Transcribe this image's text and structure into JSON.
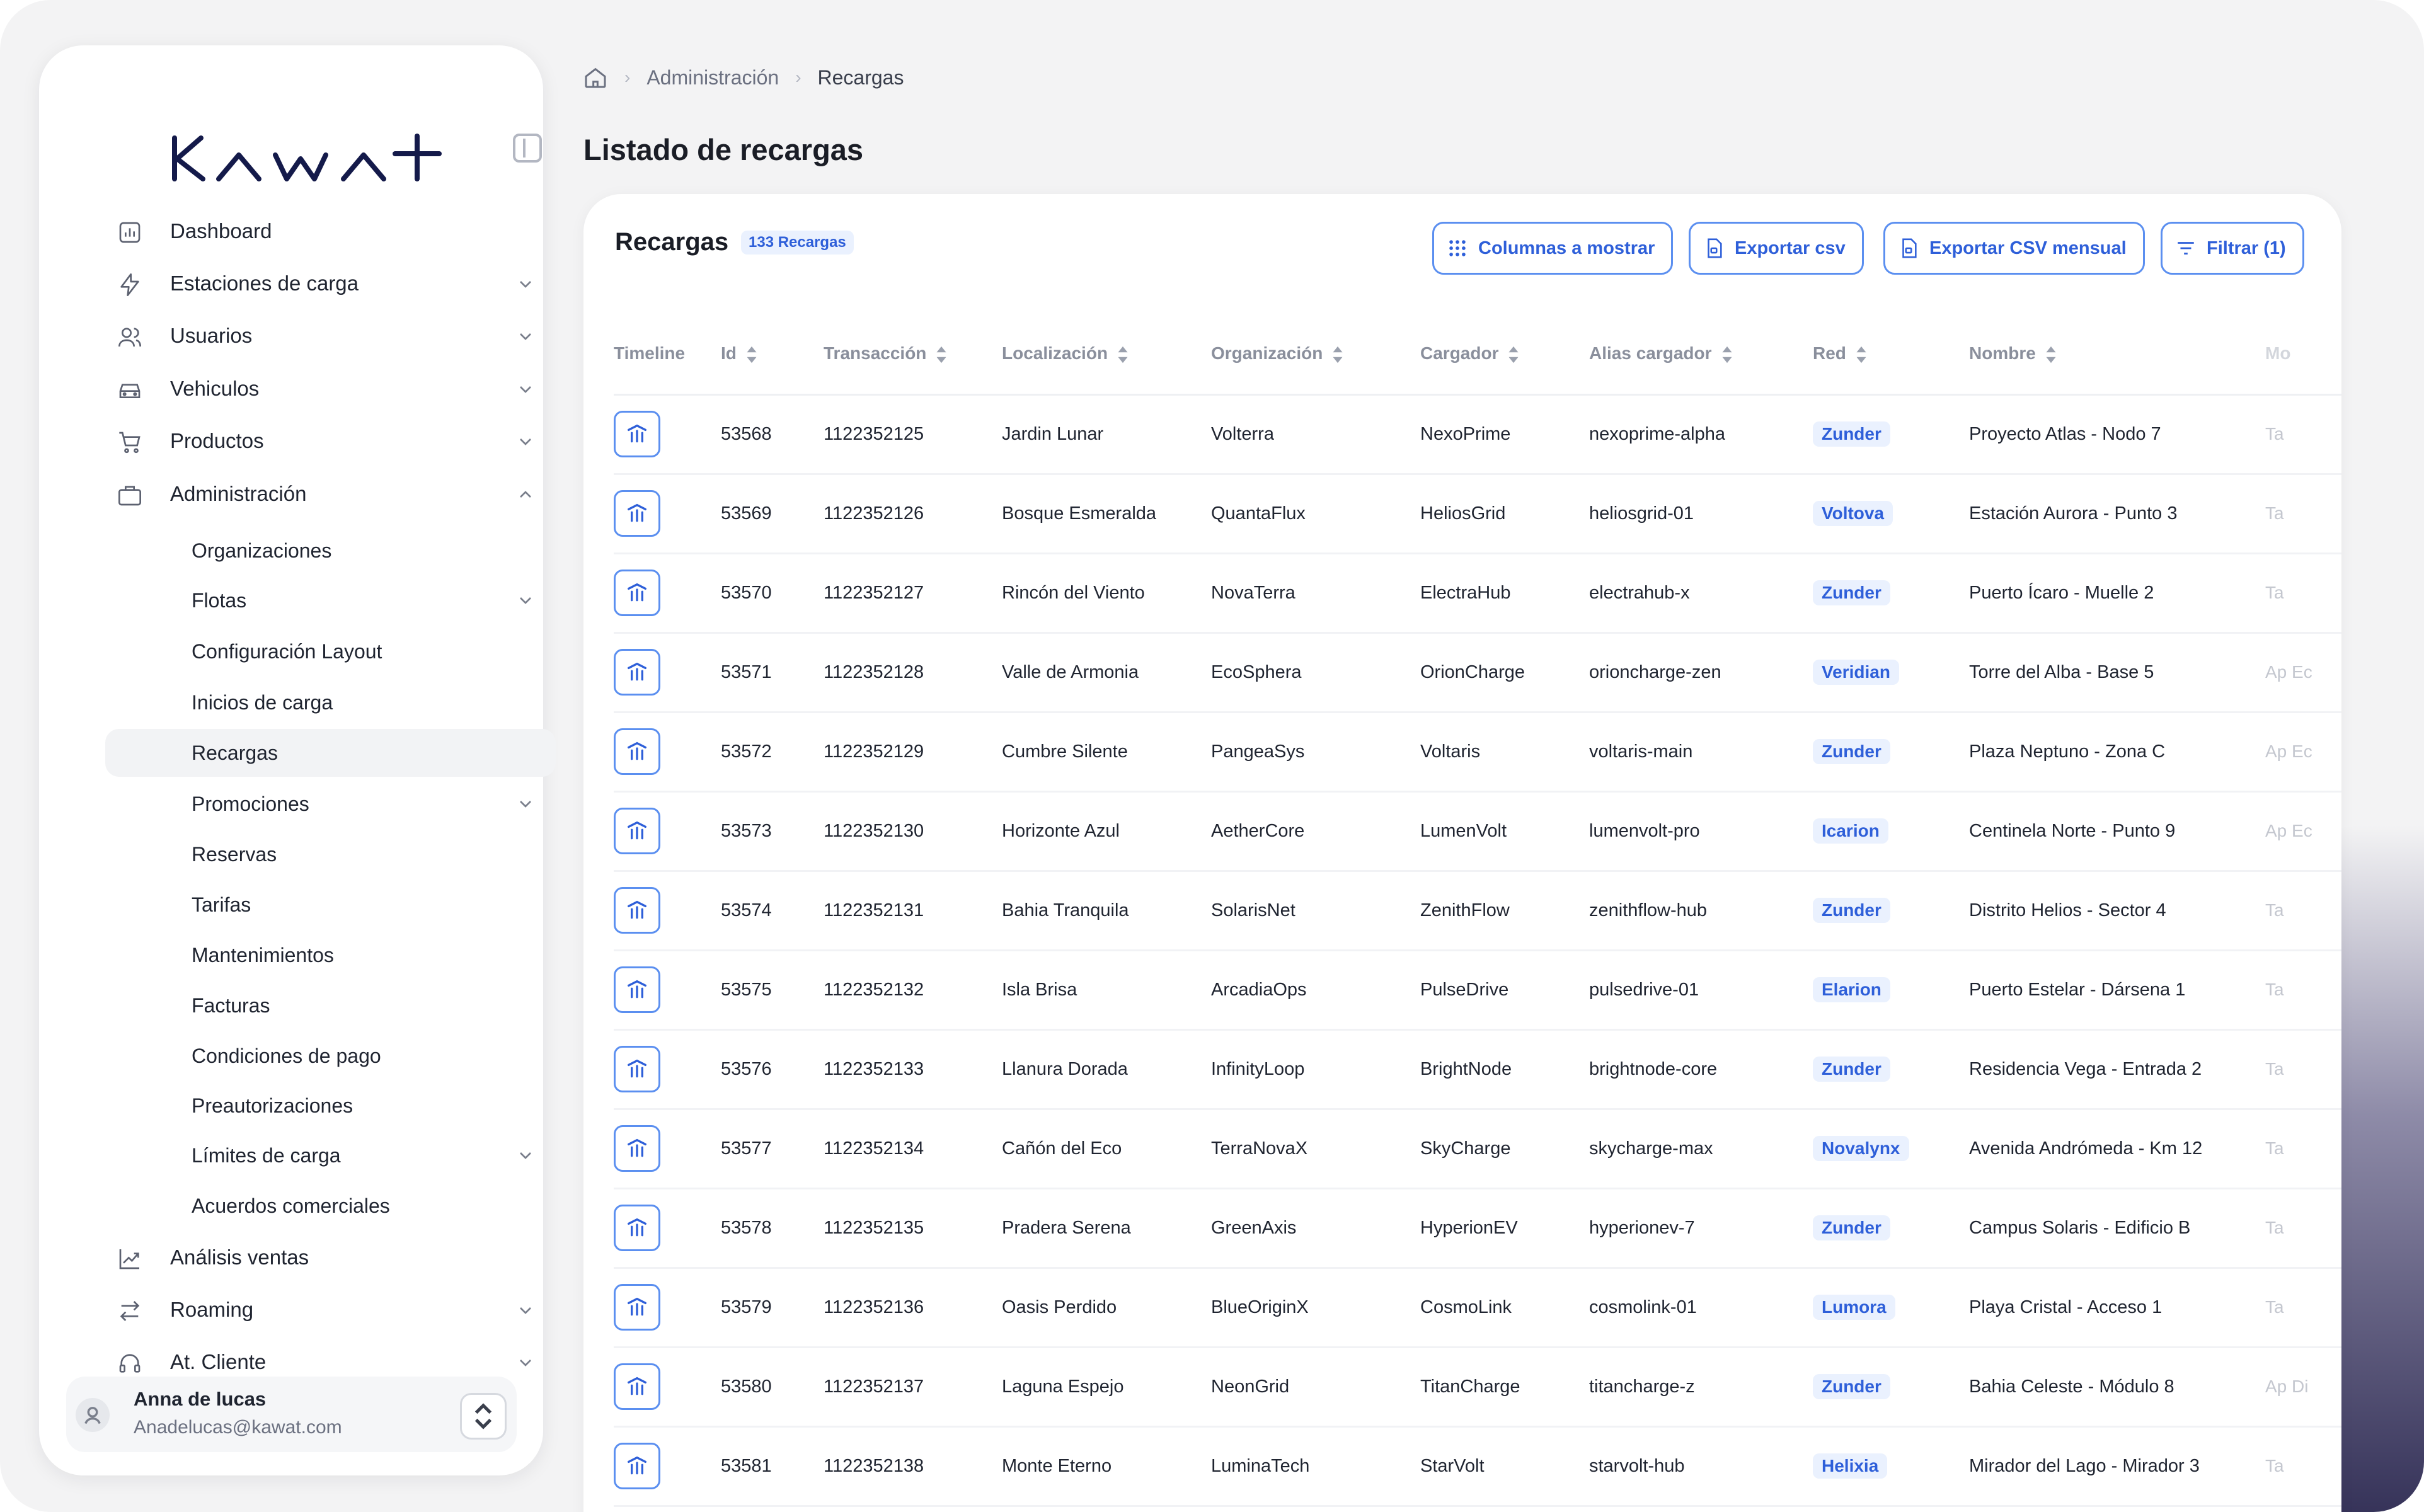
{
  "app": {
    "logo_text": "KAWAT",
    "accent_color": "#2e5fd9",
    "logo_color": "#141a4a"
  },
  "sidebar": {
    "items": [
      {
        "label": "Dashboard",
        "icon": "chart-icon",
        "expandable": false
      },
      {
        "label": "Estaciones de carga",
        "icon": "lightning-icon",
        "expandable": true
      },
      {
        "label": "Usuarios",
        "icon": "users-icon",
        "expandable": true
      },
      {
        "label": "Vehiculos",
        "icon": "car-icon",
        "expandable": true
      },
      {
        "label": "Productos",
        "icon": "cart-icon",
        "expandable": true
      },
      {
        "label": "Administración",
        "icon": "briefcase-icon",
        "expandable": true,
        "expanded": true
      }
    ],
    "admin_subitems": [
      {
        "label": "Organizaciones",
        "expandable": false
      },
      {
        "label": "Flotas",
        "expandable": true
      },
      {
        "label": "Configuración Layout",
        "expandable": false
      },
      {
        "label": "Inicios de carga",
        "expandable": false
      },
      {
        "label": "Recargas",
        "expandable": false,
        "active": true
      },
      {
        "label": "Promociones",
        "expandable": true
      },
      {
        "label": "Reservas",
        "expandable": false
      },
      {
        "label": "Tarifas",
        "expandable": false
      },
      {
        "label": "Mantenimientos",
        "expandable": false
      },
      {
        "label": "Facturas",
        "expandable": false
      },
      {
        "label": "Condiciones de pago",
        "expandable": false
      },
      {
        "label": "Preautorizaciones",
        "expandable": false
      },
      {
        "label": "Límites de carga",
        "expandable": true
      },
      {
        "label": "Acuerdos comerciales",
        "expandable": false
      }
    ],
    "bottom_items": [
      {
        "label": "Análisis ventas",
        "icon": "trend-icon",
        "expandable": false
      },
      {
        "label": "Roaming",
        "icon": "arrows-swap-icon",
        "expandable": true
      },
      {
        "label": "At. Cliente",
        "icon": "headset-icon",
        "expandable": true
      }
    ],
    "user": {
      "name": "Anna de lucas",
      "email": "Anadelucas@kawat.com"
    }
  },
  "breadcrumb": {
    "items": [
      "Administración",
      "Recargas"
    ]
  },
  "page": {
    "title": "Listado de recargas"
  },
  "card": {
    "title": "Recargas",
    "count_badge": "133 Recargas",
    "buttons": {
      "columns": "Columnas a mostrar",
      "export_csv": "Exportar csv",
      "export_monthly": "Exportar CSV mensual",
      "filter": "Filtrar (1)"
    }
  },
  "table": {
    "columns": [
      "Timeline",
      "Id",
      "Transacción",
      "Localización",
      "Organización",
      "Cargador",
      "Alias cargador",
      "Red",
      "Nombre",
      "Mo"
    ],
    "rows": [
      {
        "id": "53568",
        "tx": "1122352125",
        "loc": "Jardin Lunar",
        "org": "Volterra",
        "charger": "NexoPrime",
        "alias": "nexoprime-alpha",
        "net": "Zunder",
        "name": "Proyecto Atlas - Nodo 7",
        "extra": "Ta"
      },
      {
        "id": "53569",
        "tx": "1122352126",
        "loc": "Bosque Esmeralda",
        "org": "QuantaFlux",
        "charger": "HeliosGrid",
        "alias": "heliosgrid-01",
        "net": "Voltova",
        "name": "Estación Aurora - Punto 3",
        "extra": "Ta"
      },
      {
        "id": "53570",
        "tx": "1122352127",
        "loc": "Rincón del Viento",
        "org": "NovaTerra",
        "charger": "ElectraHub",
        "alias": "electrahub-x",
        "net": "Zunder",
        "name": "Puerto Ícaro - Muelle 2",
        "extra": "Ta"
      },
      {
        "id": "53571",
        "tx": "1122352128",
        "loc": "Valle de Armonia",
        "org": "EcoSphera",
        "charger": "OrionCharge",
        "alias": "orioncharge-zen",
        "net": "Veridian",
        "name": "Torre del Alba - Base 5",
        "extra": "Ap Ec"
      },
      {
        "id": "53572",
        "tx": "1122352129",
        "loc": "Cumbre Silente",
        "org": "PangeaSys",
        "charger": "Voltaris",
        "alias": "voltaris-main",
        "net": "Zunder",
        "name": "Plaza Neptuno - Zona C",
        "extra": "Ap Ec"
      },
      {
        "id": "53573",
        "tx": "1122352130",
        "loc": "Horizonte Azul",
        "org": "AetherCore",
        "charger": "LumenVolt",
        "alias": "lumenvolt-pro",
        "net": "Icarion",
        "name": "Centinela Norte - Punto 9",
        "extra": "Ap Ec"
      },
      {
        "id": "53574",
        "tx": "1122352131",
        "loc": "Bahia Tranquila",
        "org": "SolarisNet",
        "charger": "ZenithFlow",
        "alias": "zenithflow-hub",
        "net": "Zunder",
        "name": "Distrito Helios - Sector 4",
        "extra": "Ta"
      },
      {
        "id": "53575",
        "tx": "1122352132",
        "loc": "Isla Brisa",
        "org": "ArcadiaOps",
        "charger": "PulseDrive",
        "alias": "pulsedrive-01",
        "net": "Elarion",
        "name": "Puerto Estelar - Dársena 1",
        "extra": "Ta"
      },
      {
        "id": "53576",
        "tx": "1122352133",
        "loc": "Llanura Dorada",
        "org": "InfinityLoop",
        "charger": "BrightNode",
        "alias": "brightnode-core",
        "net": "Zunder",
        "name": "Residencia Vega - Entrada 2",
        "extra": "Ta"
      },
      {
        "id": "53577",
        "tx": "1122352134",
        "loc": "Cañón del Eco",
        "org": "TerraNovaX",
        "charger": "SkyCharge",
        "alias": "skycharge-max",
        "net": "Novalynx",
        "name": "Avenida Andrómeda - Km 12",
        "extra": "Ta"
      },
      {
        "id": "53578",
        "tx": "1122352135",
        "loc": "Pradera Serena",
        "org": "GreenAxis",
        "charger": "HyperionEV",
        "alias": "hyperionev-7",
        "net": "Zunder",
        "name": "Campus Solaris - Edificio B",
        "extra": "Ta"
      },
      {
        "id": "53579",
        "tx": "1122352136",
        "loc": "Oasis Perdido",
        "org": "BlueOriginX",
        "charger": "CosmoLink",
        "alias": "cosmolink-01",
        "net": "Lumora",
        "name": "Playa Cristal - Acceso 1",
        "extra": "Ta"
      },
      {
        "id": "53580",
        "tx": "1122352137",
        "loc": "Laguna Espejo",
        "org": "NeonGrid",
        "charger": "TitanCharge",
        "alias": "titancharge-z",
        "net": "Zunder",
        "name": "Bahia Celeste - Módulo 8",
        "extra": "Ap Di"
      },
      {
        "id": "53581",
        "tx": "1122352138",
        "loc": "Monte Eterno",
        "org": "LuminaTech",
        "charger": "StarVolt",
        "alias": "starvolt-hub",
        "net": "Helixia",
        "name": "Mirador del Lago - Mirador 3",
        "extra": "Ta"
      }
    ]
  }
}
